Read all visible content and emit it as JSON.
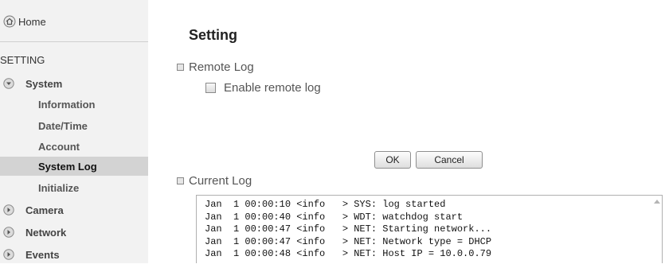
{
  "sidebar": {
    "home_label": "Home",
    "section_title": "SETTING",
    "system_label": "System",
    "system_items": [
      {
        "label": "Information"
      },
      {
        "label": "Date/Time"
      },
      {
        "label": "Account"
      },
      {
        "label": "System Log",
        "active": true
      },
      {
        "label": "Initialize"
      }
    ],
    "other_items": [
      {
        "label": "Camera"
      },
      {
        "label": "Network"
      },
      {
        "label": "Events"
      }
    ]
  },
  "main": {
    "title": "Setting",
    "remote_log": {
      "section_label": "Remote Log",
      "enable_label": "Enable remote log",
      "enable_checked": false
    },
    "buttons": {
      "ok": "OK",
      "cancel": "Cancel"
    },
    "current_log": {
      "section_label": "Current Log",
      "lines": [
        "Jan  1 00:00:10 <info   > SYS: log started",
        "Jan  1 00:00:40 <info   > WDT: watchdog start",
        "Jan  1 00:00:47 <info   > NET: Starting network...",
        "Jan  1 00:00:47 <info   > NET: Network type = DHCP",
        "Jan  1 00:00:48 <info   > NET: Host IP = 10.0.0.79"
      ]
    }
  },
  "icons": {
    "home": "home-icon",
    "expanded": "chevron-down-icon",
    "collapsed": "chevron-right-icon"
  }
}
